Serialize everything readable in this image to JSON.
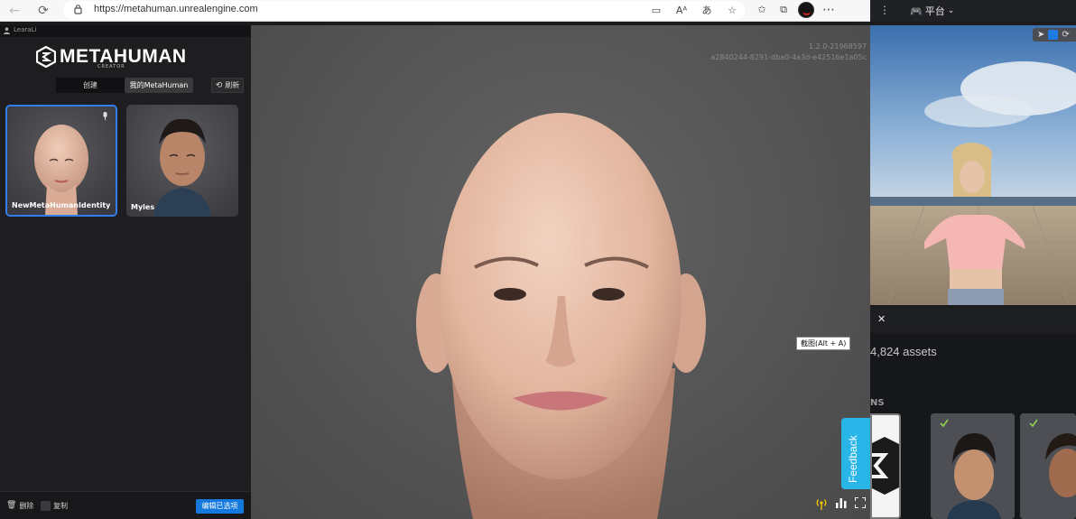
{
  "browser": {
    "url": "https://metahuman.unrealengine.com",
    "platform_label": "平台"
  },
  "app": {
    "user_name": "LearaLi",
    "logo_title": "METAHUMAN",
    "logo_subtitle": "CREATOR",
    "tabs": [
      {
        "label": "创建",
        "active": false
      },
      {
        "label": "我的MetaHuman",
        "active": true
      }
    ],
    "refresh_label": "刷新",
    "characters": [
      {
        "name": "NewMetaHumanIdentity",
        "selected": true
      },
      {
        "name": "Myles",
        "selected": false
      }
    ],
    "bottom": {
      "delete_label": "删除",
      "copy_label": "复制",
      "edit_label": "编辑已选项"
    }
  },
  "viewport": {
    "version": "1.2.0-21968597",
    "build_hash": "a2840244-8291-dba0-4a3d-e42516e1a05c",
    "tooltip": "截图(Alt + A)"
  },
  "right_panel": {
    "assets_count": "4,824 assets",
    "section_label": "NS",
    "feedback_label": "Feedback"
  },
  "colors": {
    "accent": "#1478dc",
    "feedback": "#2ab5e8",
    "selection": "#2f7ff0"
  },
  "icons": [
    "back-icon",
    "reload-icon",
    "lock-icon",
    "search-tab-icon",
    "read-aloud-icon",
    "translate-icon",
    "favorite-icon",
    "favorites-list-icon",
    "collections-icon",
    "profile-avatar",
    "more-icon",
    "user-icon",
    "refresh-icon",
    "mic-icon",
    "trash-icon",
    "copy-icon",
    "broadcast-icon",
    "chart-icon",
    "fullscreen-icon",
    "kebab-icon",
    "gamepad-icon",
    "chevron-down-icon",
    "cursor-icon",
    "move-icon",
    "close-icon",
    "check-icon"
  ]
}
